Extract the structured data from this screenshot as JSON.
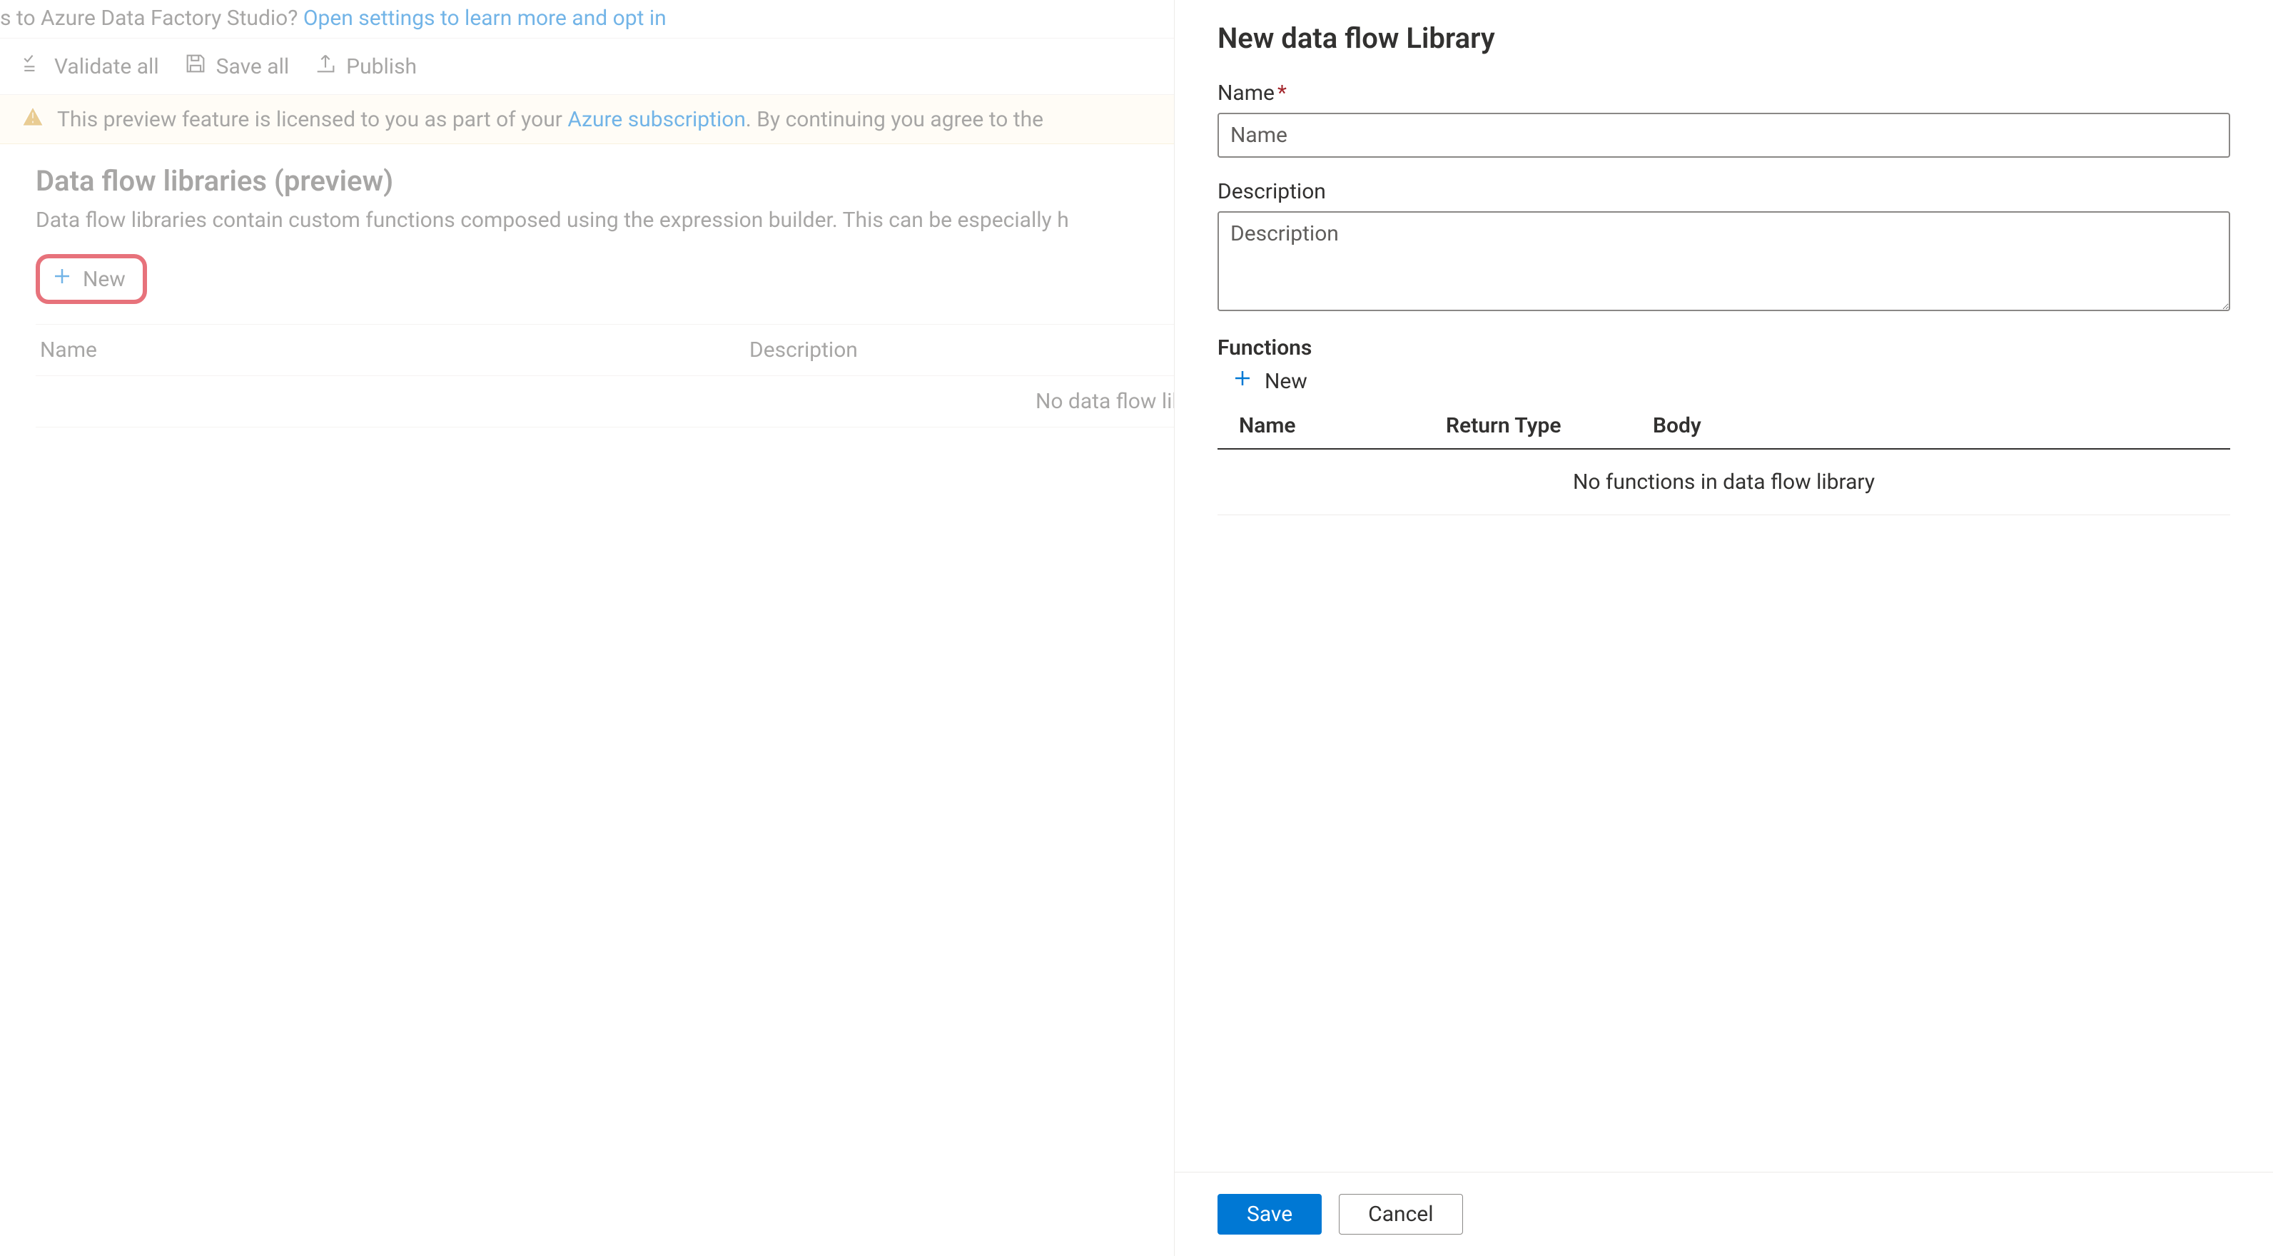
{
  "topBanner": {
    "prefix": "s to Azure Data Factory Studio? ",
    "link": "Open settings to learn more and opt in"
  },
  "toolbar": {
    "validate": "Validate all",
    "save": "Save all",
    "publish": "Publish"
  },
  "warning": {
    "prefix": "This preview feature is licensed to you as part of your ",
    "link": "Azure subscription",
    "suffix": ". By continuing you agree to the"
  },
  "main": {
    "title": "Data flow libraries (preview)",
    "desc": "Data flow libraries contain custom functions composed using the expression builder. This can be especially h",
    "newBtn": "New",
    "table": {
      "colName": "Name",
      "colDesc": "Description",
      "empty": "No data flow libraries"
    }
  },
  "panel": {
    "title": "New data flow Library",
    "nameLabel": "Name",
    "namePlaceholder": "Name",
    "descLabel": "Description",
    "descPlaceholder": "Description",
    "functionsLabel": "Functions",
    "fnNew": "New",
    "fnTable": {
      "colName": "Name",
      "colReturn": "Return Type",
      "colBody": "Body",
      "empty": "No functions in data flow library"
    },
    "save": "Save",
    "cancel": "Cancel"
  }
}
